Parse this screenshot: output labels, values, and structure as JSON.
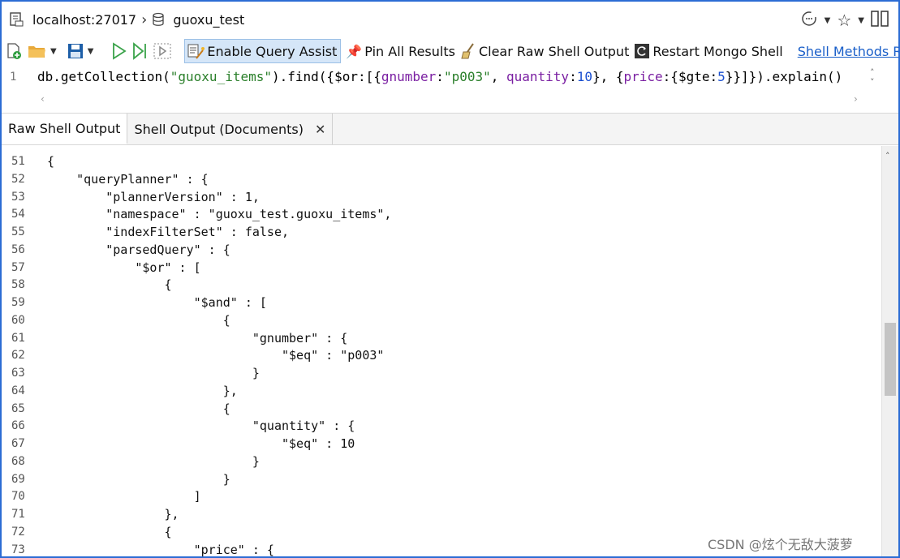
{
  "breadcrumb": {
    "server": "localhost:27017",
    "database": "guoxu_test"
  },
  "toolbar": {
    "enable_query_assist": "Enable Query Assist",
    "pin_all_results": "Pin All Results",
    "clear_raw_shell_output": "Clear Raw Shell Output",
    "restart_mongo_shell": "Restart Mongo Shell",
    "shell_methods_ref": "Shell Methods Refe"
  },
  "editor": {
    "line_number": "1",
    "code": {
      "p1": "db.getCollection(",
      "collection": "\"guoxu_items\"",
      "p2": ").find({$or:[{",
      "k1": "gnumber",
      "c1": ":",
      "v1": "\"p003\"",
      "c2": ", ",
      "k2": "quantity",
      "c3": ":",
      "v2": "10",
      "c4": "}, {",
      "k3": "price",
      "c5": ":{$gte:",
      "v3": "5",
      "c6": "}}]}).explain()"
    }
  },
  "tabs": [
    {
      "label": "Raw Shell Output"
    },
    {
      "label": "Shell Output (Documents)"
    }
  ],
  "output": {
    "lines": [
      {
        "n": "51",
        "t": "{"
      },
      {
        "n": "52",
        "t": "    \"queryPlanner\" : {"
      },
      {
        "n": "53",
        "t": "        \"plannerVersion\" : 1,"
      },
      {
        "n": "54",
        "t": "        \"namespace\" : \"guoxu_test.guoxu_items\","
      },
      {
        "n": "55",
        "t": "        \"indexFilterSet\" : false,"
      },
      {
        "n": "56",
        "t": "        \"parsedQuery\" : {"
      },
      {
        "n": "57",
        "t": "            \"$or\" : ["
      },
      {
        "n": "58",
        "t": "                {"
      },
      {
        "n": "59",
        "t": "                    \"$and\" : ["
      },
      {
        "n": "60",
        "t": "                        {"
      },
      {
        "n": "61",
        "t": "                            \"gnumber\" : {"
      },
      {
        "n": "62",
        "t": "                                \"$eq\" : \"p003\""
      },
      {
        "n": "63",
        "t": "                            }"
      },
      {
        "n": "64",
        "t": "                        },"
      },
      {
        "n": "65",
        "t": "                        {"
      },
      {
        "n": "66",
        "t": "                            \"quantity\" : {"
      },
      {
        "n": "67",
        "t": "                                \"$eq\" : 10"
      },
      {
        "n": "68",
        "t": "                            }"
      },
      {
        "n": "69",
        "t": "                        }"
      },
      {
        "n": "70",
        "t": "                    ]"
      },
      {
        "n": "71",
        "t": "                },"
      },
      {
        "n": "72",
        "t": "                {"
      },
      {
        "n": "73",
        "t": "                    \"price\" : {"
      }
    ]
  },
  "watermark": "CSDN @炫个无敌大菠萝",
  "colors": {
    "accent": "#2b6cd4",
    "string": "#2a7f2a",
    "link": "#1a5fc9"
  }
}
